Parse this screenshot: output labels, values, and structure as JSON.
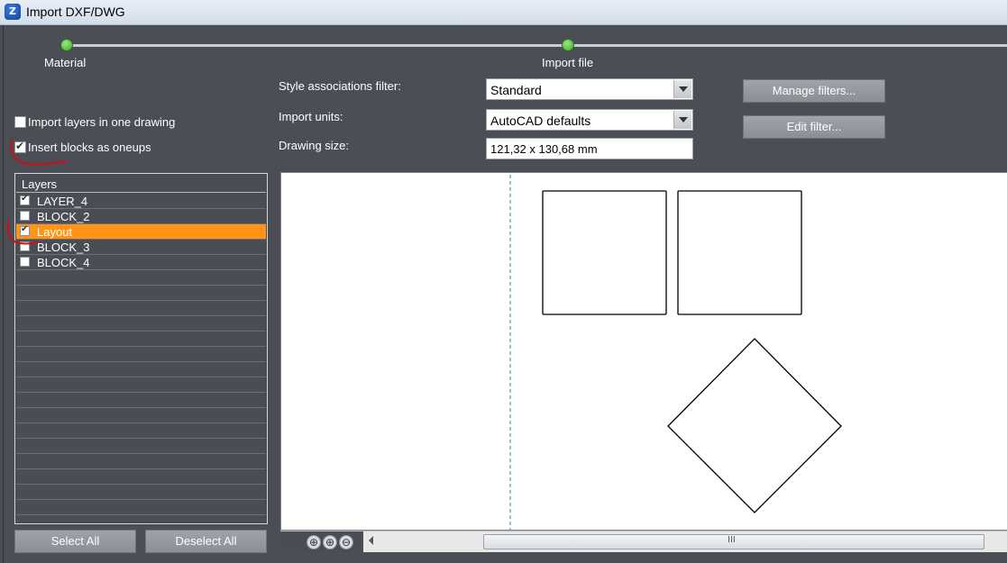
{
  "window": {
    "title": "Import DXF/DWG",
    "app_icon": "app-logo-icon"
  },
  "stepper": {
    "steps": [
      {
        "label": "Material"
      },
      {
        "label": "Import file"
      }
    ]
  },
  "options": {
    "import_layers_label": "Import layers in one drawing",
    "import_layers_checked": false,
    "insert_blocks_label": "Insert blocks as oneups",
    "insert_blocks_checked": true
  },
  "form": {
    "style_filter_label": "Style associations filter:",
    "style_filter_value": "Standard",
    "import_units_label": "Import units:",
    "import_units_value": "AutoCAD defaults",
    "drawing_size_label": "Drawing size:",
    "drawing_size_value": "121,32 x 130,68 mm"
  },
  "buttons": {
    "manage_filters": "Manage filters...",
    "edit_filter": "Edit filter...",
    "select_all": "Select All",
    "deselect_all": "Deselect All"
  },
  "layers": {
    "header": "Layers",
    "items": [
      {
        "name": "LAYER_4",
        "checked": true,
        "selected": false
      },
      {
        "name": "BLOCK_2",
        "checked": false,
        "selected": false
      },
      {
        "name": "Layout",
        "checked": true,
        "selected": true
      },
      {
        "name": "BLOCK_3",
        "checked": false,
        "selected": false
      },
      {
        "name": "BLOCK_4",
        "checked": false,
        "selected": false
      }
    ]
  },
  "zoom": {
    "icons": [
      "zoom-fit-icon",
      "zoom-in-icon",
      "zoom-out-icon"
    ]
  },
  "scrollbar": {
    "grip": "III"
  },
  "colors": {
    "selection": "#ff9416",
    "step_dot": "#3ea92a",
    "background": "#4a4d54",
    "annotation": "#cc1111"
  }
}
